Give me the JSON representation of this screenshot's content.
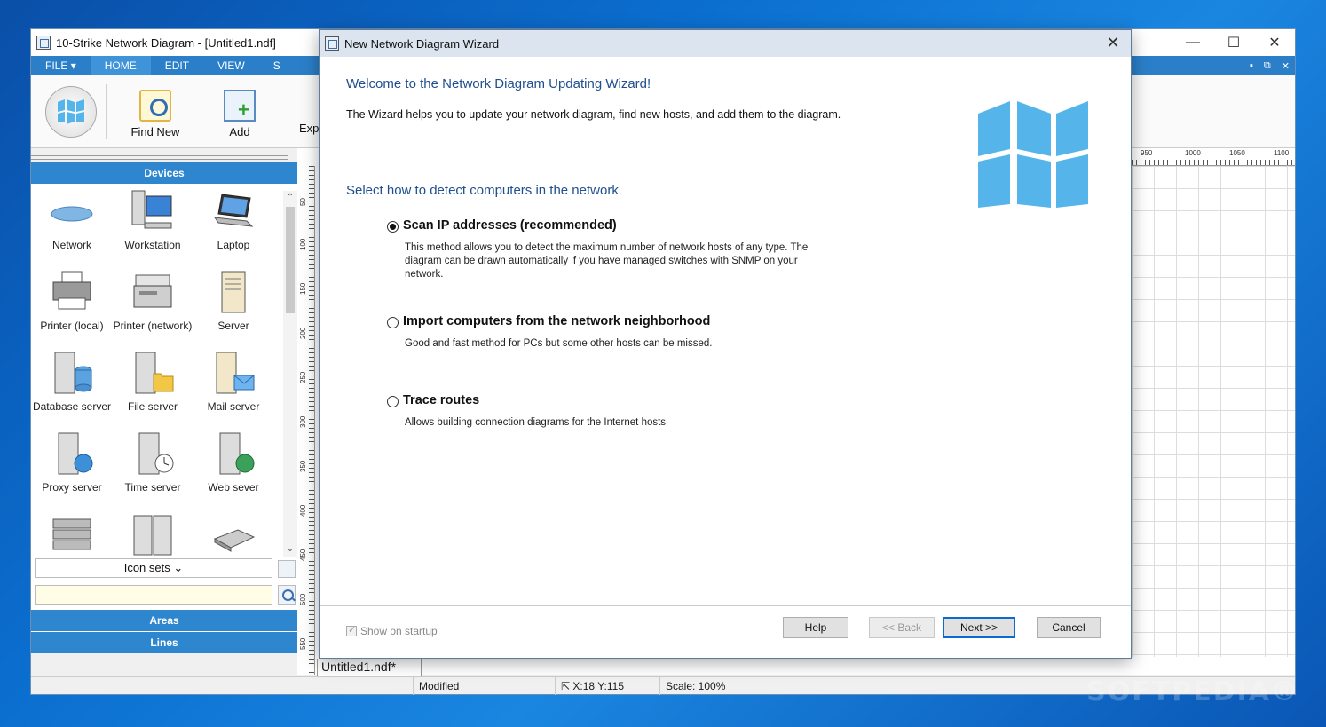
{
  "app": {
    "title": "10-Strike Network Diagram - [Untitled1.ndf]",
    "window_controls": {
      "minimize": "—",
      "maximize": "☐",
      "close": "✕"
    },
    "ribbon_tabs": [
      "FILE",
      "HOME",
      "EDIT",
      "VIEW",
      "S"
    ],
    "file_tab_chevron": "▾",
    "mdi_controls": {
      "minimize": "▪",
      "restore": "⧉",
      "close": "✕"
    },
    "ribbon_buttons": {
      "find_new": "Find New",
      "add": "Add",
      "export": "Exp"
    },
    "devices_header": "Devices",
    "devices": [
      "Network",
      "Workstation",
      "Laptop",
      "Printer (local)",
      "Printer (network)",
      "Server",
      "Database server",
      "File server",
      "Mail server",
      "Proxy server",
      "Time server",
      "Web sever",
      "",
      "",
      ""
    ],
    "scroll_up": "⌃",
    "scroll_down": "⌄",
    "icon_sets": "Icon sets",
    "icon_sets_chevron": "⌄",
    "areas": "Areas",
    "lines": "Lines",
    "doc_tab": "Untitled1.ndf*",
    "ruler_h": [
      "950",
      "1000",
      "1050",
      "1100"
    ],
    "ruler_v": [
      "50",
      "100",
      "150",
      "200",
      "250",
      "300",
      "350",
      "400",
      "450",
      "500",
      "550"
    ],
    "status": {
      "modified": "Modified",
      "coords": "X:18 Y:115",
      "scale": "Scale: 100%"
    }
  },
  "wizard": {
    "title": "New Network Diagram Wizard",
    "close": "✕",
    "heading": "Welcome to the Network Diagram Updating Wizard!",
    "intro": "The Wizard helps you to update your network diagram, find new hosts, and add them to the diagram.",
    "subheading": "Select how to detect computers in the network",
    "options": [
      {
        "label": "Scan IP addresses (recommended)",
        "desc": "This method allows you to detect the maximum number of network hosts of any type. The diagram can be drawn automatically if you have managed switches with SNMP on your network.",
        "selected": true
      },
      {
        "label": "Import computers from the network neighborhood",
        "desc": "Good and fast method for PCs but some other hosts can be missed.",
        "selected": false
      },
      {
        "label": "Trace routes",
        "desc": "Allows building connection diagrams for the Internet hosts",
        "selected": false
      }
    ],
    "show_on_startup": "Show on startup",
    "buttons": {
      "help": "Help",
      "back": "<< Back",
      "next": "Next >>",
      "cancel": "Cancel"
    }
  },
  "watermark": "SOFTPEDIA®",
  "colors": {
    "accent": "#2b7fc8",
    "wizard_heading": "#1f4f8f",
    "logo": "#55b4ea"
  }
}
